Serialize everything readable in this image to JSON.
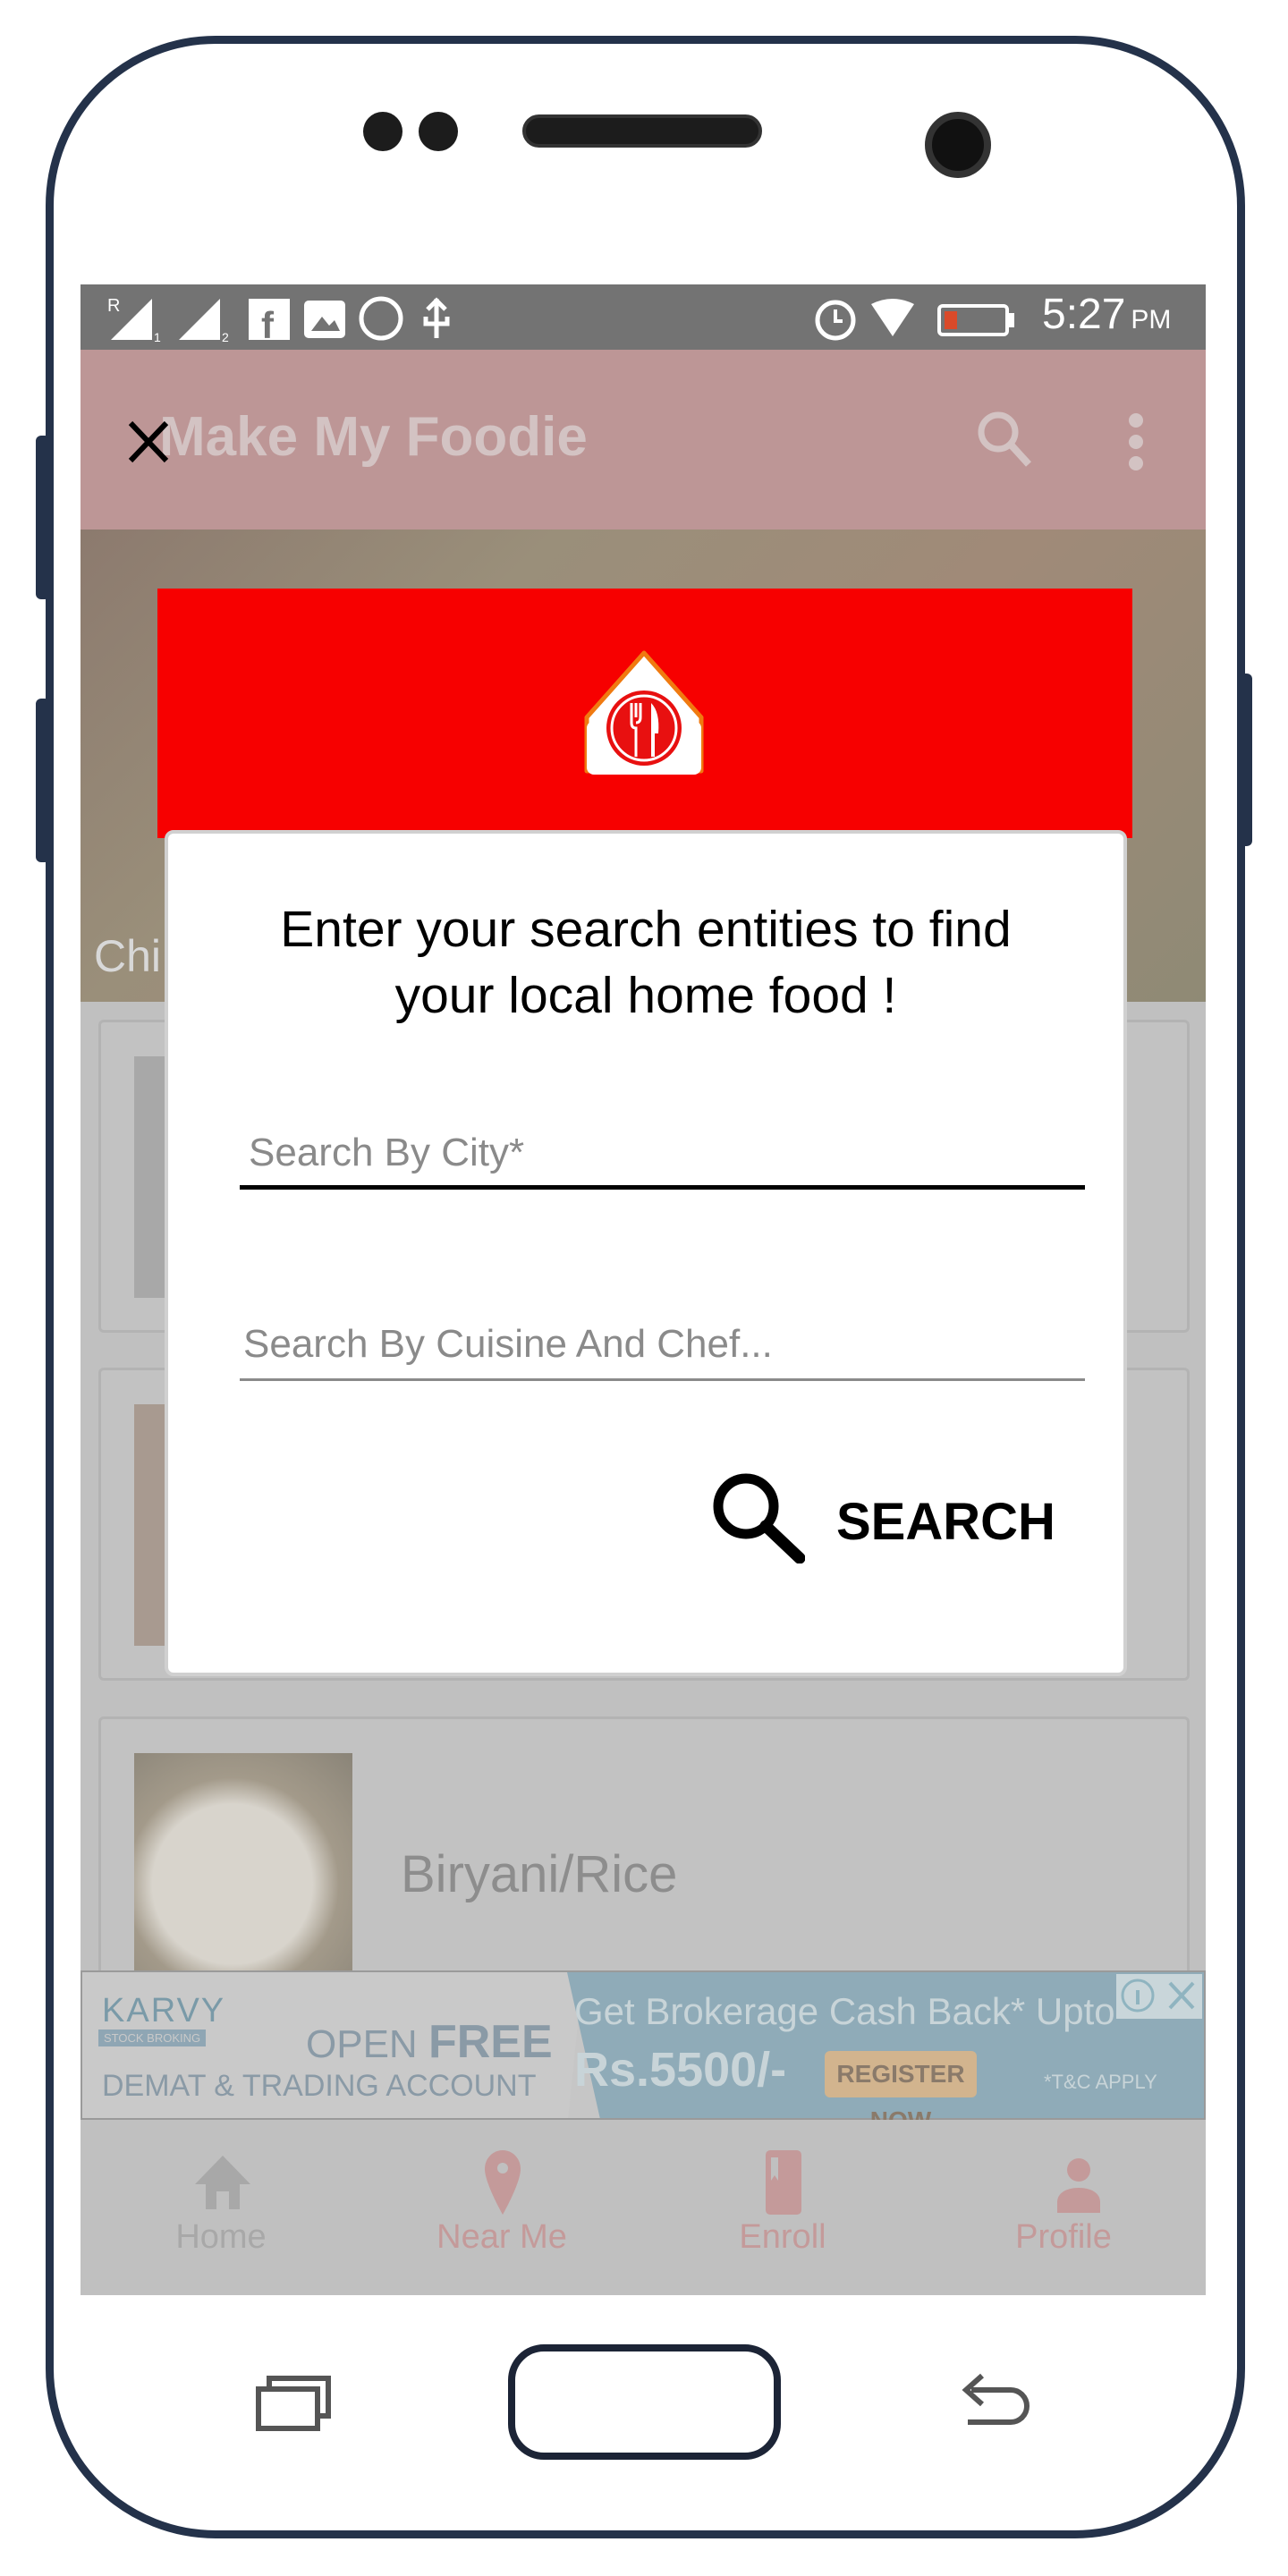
{
  "status_bar": {
    "time": "5:27",
    "ampm": "PM",
    "battery": "6%",
    "icons": [
      "signal-r1-icon",
      "signal-2-icon",
      "facebook-icon",
      "gallery-icon",
      "whatsapp-icon",
      "usb-icon",
      "alarm-icon",
      "wifi-icon",
      "battery-icon"
    ]
  },
  "app_bar": {
    "title": "Make My Foodie",
    "close_icon": "close-icon",
    "search_icon": "search-icon",
    "menu_icon": "more-vert-icon"
  },
  "hero": {
    "caption": "Chi"
  },
  "list": [
    {
      "label": ""
    },
    {
      "label": ""
    },
    {
      "label": "Biryani/Rice"
    }
  ],
  "ad": {
    "brand": "KARVY",
    "brand_sub": "STOCK BROKING",
    "open": "OPEN",
    "free": "FREE",
    "account": "DEMAT & TRADING ACCOUNT",
    "headline": "Get Brokerage Cash Back* Upto",
    "amount": "Rs.5500/-",
    "cta": "REGISTER NOW",
    "terms": "*T&C APPLY"
  },
  "bottom_nav": [
    {
      "label": "Home",
      "icon": "home-icon"
    },
    {
      "label": "Near Me",
      "icon": "location-pin-icon"
    },
    {
      "label": "Enroll",
      "icon": "book-icon"
    },
    {
      "label": "Profile",
      "icon": "person-icon"
    }
  ],
  "dialog": {
    "title_line1": "Enter your search entities to find",
    "title_line2": "your local home food !",
    "city_placeholder": "Search By City*",
    "cuisine_placeholder": "Search By Cuisine And Chef...",
    "search_label": "SEARCH"
  },
  "colors": {
    "header_red": "#f70000",
    "appbar_dim": "#bd9696",
    "status_bar": "#737373",
    "phone_frame": "#24324a"
  }
}
